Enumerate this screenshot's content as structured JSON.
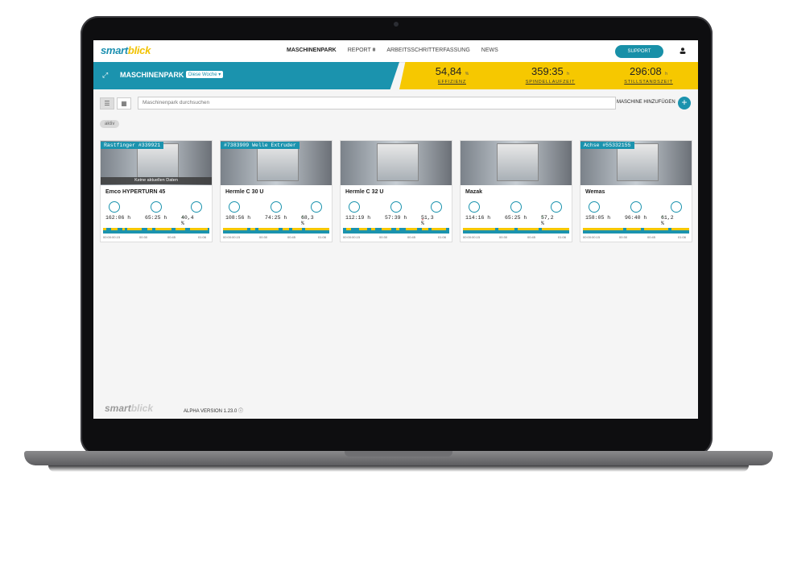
{
  "app": {
    "logo_part1": "smart",
    "logo_part2": "blick"
  },
  "nav": {
    "items": [
      {
        "label": "MASCHINENPARK",
        "active": true
      },
      {
        "label": "REPORT ⩩",
        "active": false
      },
      {
        "label": "ARBEITSSCHRITTERFASSUNG",
        "active": false
      },
      {
        "label": "NEWS",
        "active": false
      }
    ],
    "support_label": "SUPPORT"
  },
  "header": {
    "title": "MASCHINENPARK",
    "filter": "Diese Woche",
    "kpis": [
      {
        "value": "54,84",
        "unit": "%",
        "label": "EFFIZIENZ"
      },
      {
        "value": "359:35",
        "unit": "h",
        "label": "SPINDELLAUFZEIT"
      },
      {
        "value": "296:08",
        "unit": "h",
        "label": "STILLSTANDSZEIT"
      }
    ]
  },
  "toolbar": {
    "search_placeholder": "Maschinenpark durchsuchen",
    "add_label": "MASCHINE HINZUFÜGEN",
    "filter_chip": "aktiv"
  },
  "machines": [
    {
      "tag": "Rastfinger #339921",
      "name": "Emco HYPERTURN 45",
      "runtime": "162:06 h",
      "spindle": "65:25 h",
      "efficiency": "40,4 %",
      "trend": "up",
      "no_data": "Keine aktuellen Daten",
      "ticks": [
        "00:00:00.15",
        "00:30",
        "00:45",
        "01:06"
      ]
    },
    {
      "tag": "#7383909 Welle Extruder",
      "name": "Hermle C 30 U",
      "runtime": "108:56 h",
      "spindle": "74:25 h",
      "efficiency": "68,3 %",
      "trend": "up",
      "no_data": "",
      "ticks": [
        "00:00:00.15",
        "00:30",
        "00:45",
        "01:06"
      ]
    },
    {
      "tag": "",
      "name": "Hermle C 32 U",
      "runtime": "112:19 h",
      "spindle": "57:39 h",
      "efficiency": "51,3 %",
      "trend": "down",
      "no_data": "",
      "ticks": [
        "00:00:00.15",
        "00:30",
        "00:45",
        "01:06"
      ]
    },
    {
      "tag": "",
      "name": "Mazak",
      "runtime": "114:16 h",
      "spindle": "65:25 h",
      "efficiency": "57,2 %",
      "trend": "up",
      "no_data": "",
      "ticks": [
        "00:00:00.15",
        "00:30",
        "00:45",
        "01:06"
      ]
    },
    {
      "tag": "Achse #55332155",
      "name": "Wemas",
      "runtime": "158:05 h",
      "spindle": "96:40 h",
      "efficiency": "61,2 %",
      "trend": "up",
      "no_data": "",
      "ticks": [
        "00:00:00.15",
        "00:30",
        "00:45",
        "01:06"
      ]
    }
  ],
  "footer": {
    "version": "ALPHA VERSION 1.23.0 ⓘ"
  },
  "colors": {
    "primary": "#1b93ae",
    "accent": "#f6c800",
    "up": "#2aa848",
    "down": "#d42222"
  }
}
